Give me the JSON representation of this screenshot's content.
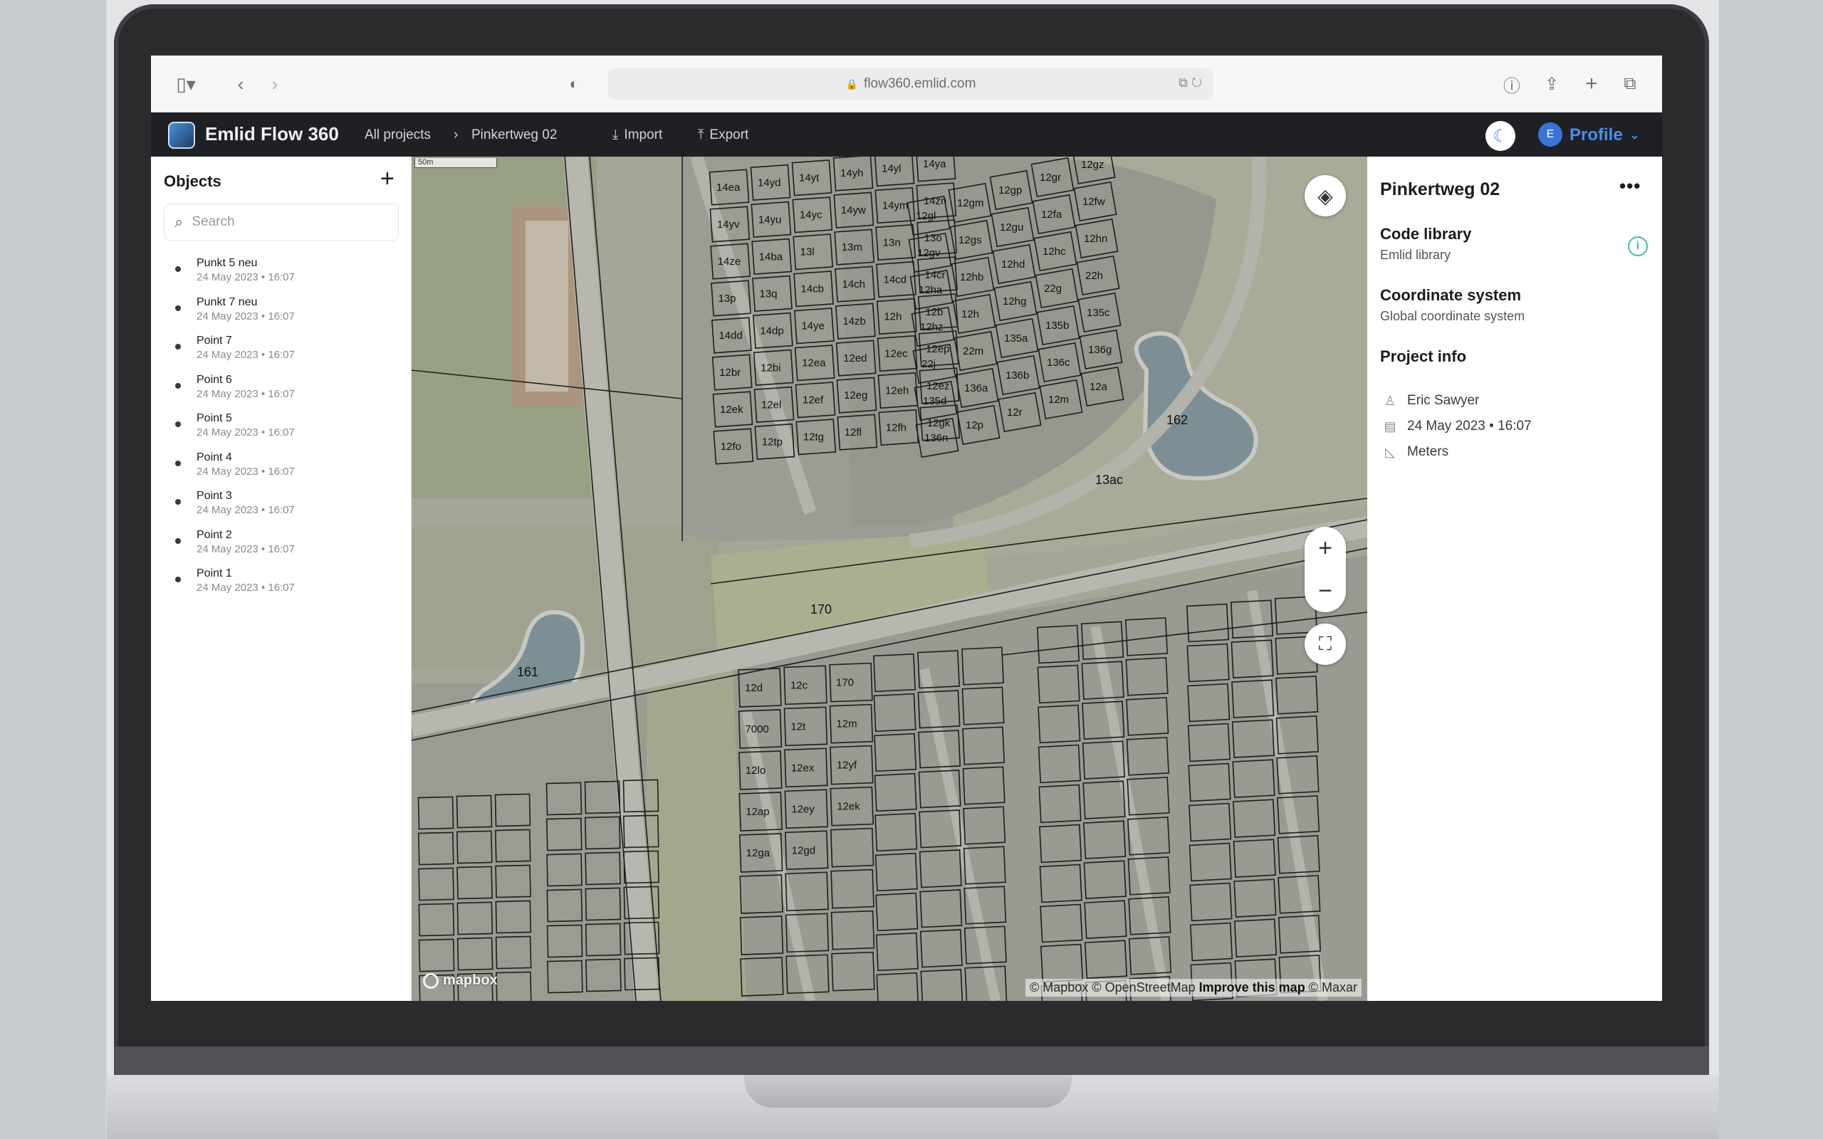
{
  "browser": {
    "url": "flow360.emlid.com"
  },
  "app": {
    "name": "Emlid Flow 360",
    "breadcrumb": [
      "All projects",
      "Pinkertweg 02"
    ],
    "actions": {
      "import": "Import",
      "export": "Export"
    },
    "profile": {
      "avatar_initial": "E",
      "label": "Profile"
    }
  },
  "objects": {
    "title": "Objects",
    "search_placeholder": "Search",
    "items": [
      {
        "name": "Punkt 5 neu",
        "date": "24 May 2023 • 16:07"
      },
      {
        "name": "Punkt 7 neu",
        "date": "24 May 2023 • 16:07"
      },
      {
        "name": "Point 7",
        "date": "24 May 2023 • 16:07"
      },
      {
        "name": "Point 6",
        "date": "24 May 2023 • 16:07"
      },
      {
        "name": "Point 5",
        "date": "24 May 2023 • 16:07"
      },
      {
        "name": "Point 4",
        "date": "24 May 2023 • 16:07"
      },
      {
        "name": "Point 3",
        "date": "24 May 2023 • 16:07"
      },
      {
        "name": "Point 2",
        "date": "24 May 2023 • 16:07"
      },
      {
        "name": "Point 1",
        "date": "24 May 2023 • 16:07"
      }
    ]
  },
  "map": {
    "scale_label": "50m",
    "logo": "mapbox",
    "attribution_prefix": "© Mapbox © OpenStreetMap",
    "attribution_link": "Improve this map",
    "attribution_suffix": "© Maxar",
    "parcel_labels": [
      "14ea",
      "14yd",
      "14yt",
      "14yh",
      "14yl",
      "14ya",
      "14yv",
      "14yu",
      "14yc",
      "14yw",
      "14ym",
      "14zn",
      "14ze",
      "14ba",
      "13l",
      "13m",
      "13n",
      "13o",
      "13p",
      "13q",
      "14cb",
      "14ch",
      "14cd",
      "14cr",
      "14dd",
      "14dp",
      "14ye",
      "14zb",
      "12h",
      "12b",
      "12br",
      "12bi",
      "12ea",
      "12ed",
      "12ec",
      "12ep",
      "12ek",
      "12el",
      "12ef",
      "12eg",
      "12eh",
      "12ez",
      "12fo",
      "12tp",
      "12tg",
      "12fl",
      "12fh",
      "12gk",
      "12gl",
      "12gm",
      "12gp",
      "12gr",
      "12gz",
      "12gv",
      "12gs",
      "12gu",
      "12fa",
      "12fw",
      "12ha",
      "12hb",
      "12hd",
      "12hc",
      "12hn",
      "12hz",
      "12h",
      "12hg",
      "22g",
      "22h",
      "22j",
      "22m",
      "135a",
      "135b",
      "135c",
      "135d",
      "136a",
      "136b",
      "136c",
      "136g",
      "136n",
      "12p",
      "12r",
      "12m",
      "12a",
      "12d",
      "12c",
      "170",
      "7000",
      "12t",
      "12m",
      "12lo",
      "12ex",
      "12yf",
      "12ap",
      "12ey",
      "12ek",
      "12ga",
      "12gd"
    ],
    "area_labels": {
      "pond_1": "161",
      "pond_2": "162",
      "field": "13ac",
      "road": "13ac",
      "strip": "170"
    }
  },
  "project": {
    "title": "Pinkertweg 02",
    "code_library_label": "Code library",
    "code_library_value": "Emlid library",
    "coordinate_system_label": "Coordinate system",
    "coordinate_system_value": "Global coordinate system",
    "project_info_label": "Project info",
    "author": "Eric Sawyer",
    "created": "24 May 2023 • 16:07",
    "units": "Meters"
  },
  "colors": {
    "header_bg": "#1f2023",
    "accent_blue": "#4b8df0",
    "info_green": "#3fbf9a"
  },
  "icons": [
    "sidebar-toggle-icon",
    "back-icon",
    "forward-icon",
    "shield-icon",
    "lock-icon",
    "translate-icon",
    "reload-icon",
    "info-icon",
    "share-icon",
    "new-tab-icon",
    "tabs-icon",
    "app-logo-icon",
    "import-icon",
    "export-icon",
    "moon-icon",
    "chevron-down-icon",
    "plus-icon",
    "search-icon",
    "layers-icon",
    "zoom-in-icon",
    "zoom-out-icon",
    "fullscreen-icon",
    "more-icon",
    "user-icon",
    "calendar-icon",
    "ruler-icon"
  ]
}
